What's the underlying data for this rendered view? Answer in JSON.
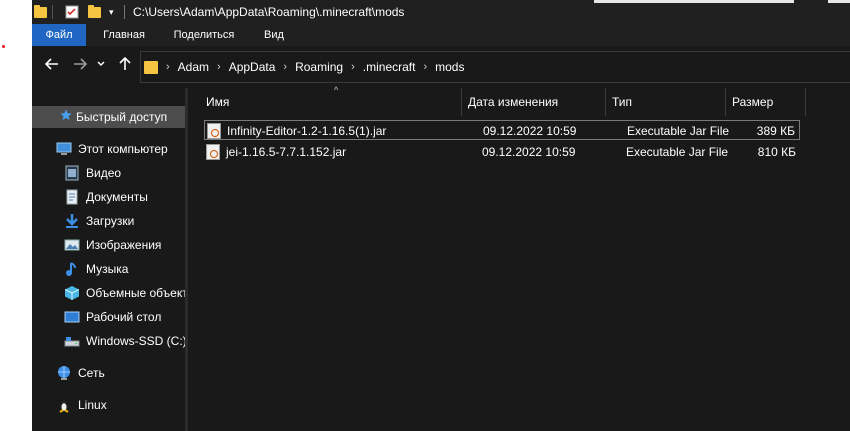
{
  "window": {
    "title_path": "C:\\Users\\Adam\\AppData\\Roaming\\.minecraft\\mods"
  },
  "ribbon": {
    "tabs": [
      {
        "label": "Файл"
      },
      {
        "label": "Главная"
      },
      {
        "label": "Поделиться"
      },
      {
        "label": "Вид"
      }
    ]
  },
  "address": {
    "crumbs": [
      "Adam",
      "AppData",
      "Roaming",
      ".minecraft",
      "mods"
    ]
  },
  "sidebar": {
    "items": [
      {
        "label": "Быстрый доступ",
        "icon": "star-icon"
      },
      {
        "label": "Этот компьютер",
        "icon": "computer-icon"
      },
      {
        "label": "Видео",
        "icon": "video-icon"
      },
      {
        "label": "Документы",
        "icon": "documents-icon"
      },
      {
        "label": "Загрузки",
        "icon": "downloads-icon"
      },
      {
        "label": "Изображения",
        "icon": "pictures-icon"
      },
      {
        "label": "Музыка",
        "icon": "music-icon"
      },
      {
        "label": "Объемные объекты",
        "icon": "3d-objects-icon"
      },
      {
        "label": "Рабочий стол",
        "icon": "desktop-icon"
      },
      {
        "label": "Windows-SSD (C:)",
        "icon": "drive-icon"
      },
      {
        "label": "Сеть",
        "icon": "network-icon"
      },
      {
        "label": "Linux",
        "icon": "linux-icon"
      }
    ]
  },
  "columns": {
    "name": "Имя",
    "modified": "Дата изменения",
    "type": "Тип",
    "size": "Размер"
  },
  "files": [
    {
      "name": "Infinity-Editor-1.2-1.16.5(1).jar",
      "modified": "09.12.2022 10:59",
      "type": "Executable Jar File",
      "size": "389 КБ"
    },
    {
      "name": "jei-1.16.5-7.7.1.152.jar",
      "modified": "09.12.2022 10:59",
      "type": "Executable Jar File",
      "size": "810 КБ"
    }
  ],
  "colors": {
    "background": "#191919",
    "ribbon_file_tab": "#1f67c2",
    "folder": "#f5c542",
    "selected_sidebar": "#4d4d4d"
  }
}
